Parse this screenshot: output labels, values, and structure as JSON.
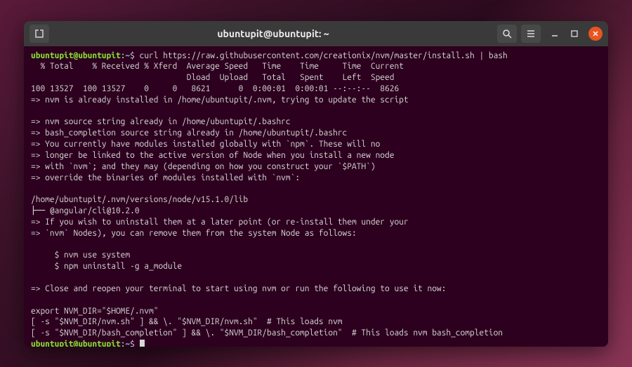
{
  "titlebar": {
    "title": "ubuntupit@ubuntupit: ~"
  },
  "prompt": {
    "user_host": "ubuntupit@ubuntupit",
    "colon": ":",
    "path": "~",
    "dollar": "$ "
  },
  "command1": "curl https://raw.githubusercontent.com/creationix/nvm/master/install.sh | bash",
  "output": {
    "l1": "  % Total    % Received % Xferd  Average Speed   Time    Time     Time  Current",
    "l2": "                                 Dload  Upload   Total   Spent    Left  Speed",
    "l3": "100 13527  100 13527    0     0   8621      0  0:00:01  0:00:01 --:--:--  8626",
    "l4": "=> nvm is already installed in /home/ubuntupit/.nvm, trying to update the script",
    "l5": "",
    "l6": "=> nvm source string already in /home/ubuntupit/.bashrc",
    "l7": "=> bash_completion source string already in /home/ubuntupit/.bashrc",
    "l8": "=> You currently have modules installed globally with `npm`. These will no",
    "l9": "=> longer be linked to the active version of Node when you install a new node",
    "l10": "=> with `nvm`; and they may (depending on how you construct your `$PATH`)",
    "l11": "=> override the binaries of modules installed with `nvm`:",
    "l12": "",
    "l13": "/home/ubuntupit/.nvm/versions/node/v15.1.0/lib",
    "l14": "├── @angular/cli@10.2.0",
    "l15": "=> If you wish to uninstall them at a later point (or re-install them under your",
    "l16": "=> `nvm` Nodes), you can remove them from the system Node as follows:",
    "l17": "",
    "l18": "     $ nvm use system",
    "l19": "     $ npm uninstall -g a_module",
    "l20": "",
    "l21": "=> Close and reopen your terminal to start using nvm or run the following to use it now:",
    "l22": "",
    "l23": "export NVM_DIR=\"$HOME/.nvm\"",
    "l24": "[ -s \"$NVM_DIR/nvm.sh\" ] && \\. \"$NVM_DIR/nvm.sh\"  # This loads nvm",
    "l25": "[ -s \"$NVM_DIR/bash_completion\" ] && \\. \"$NVM_DIR/bash_completion\"  # This loads nvm bash_completion"
  }
}
